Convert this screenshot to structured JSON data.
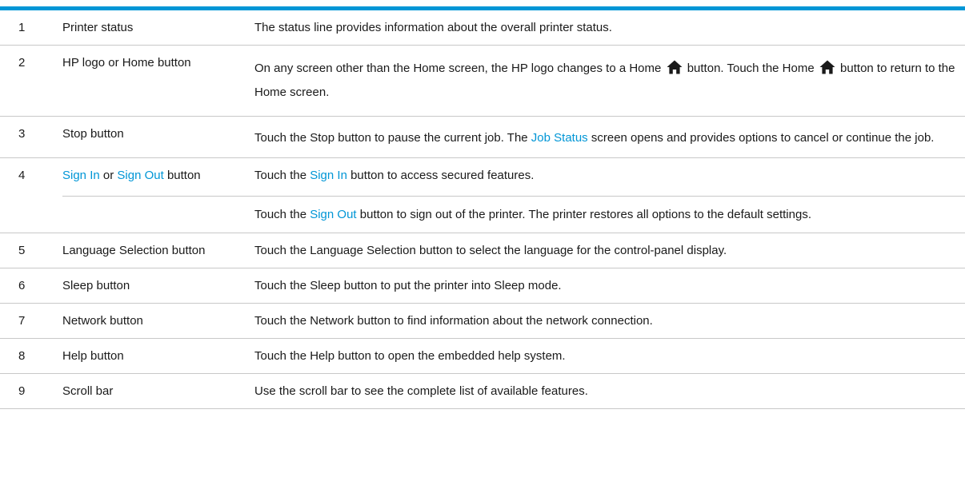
{
  "colors": {
    "accent": "#0096d6",
    "rule": "#c8c8c8"
  },
  "rows": [
    {
      "num": "1",
      "name": "Printer status",
      "desc": "The status line provides information about the overall printer status."
    },
    {
      "num": "2",
      "name": "HP logo or Home button",
      "desc_a": "On any screen other than the Home screen, the HP logo changes to a Home",
      "desc_b": "button. Touch the Home",
      "desc_c": "button to return to the Home screen.",
      "icon": "home-icon"
    },
    {
      "num": "3",
      "name": "Stop button",
      "desc_a": "Touch the Stop button to pause the current job. The",
      "desc_link": "Job Status",
      "desc_b": "screen opens and provides options to cancel or continue the job."
    },
    {
      "num": "4",
      "name_link_a": "Sign In",
      "name_mid": "or",
      "name_link_b": "Sign Out",
      "name_end": "button",
      "p1_a": "Touch the",
      "p1_link": "Sign In",
      "p1_b": "button to access secured features.",
      "p2_a": "Touch the",
      "p2_link": "Sign Out",
      "p2_b": "button to sign out of the printer. The printer restores all options to the default settings."
    },
    {
      "num": "5",
      "name": "Language Selection button",
      "desc": "Touch the Language Selection button to select the language for the control-panel display."
    },
    {
      "num": "6",
      "name": "Sleep button",
      "desc": "Touch the Sleep button to put the printer into Sleep mode."
    },
    {
      "num": "7",
      "name": "Network button",
      "desc": "Touch the Network button to find information about the network connection."
    },
    {
      "num": "8",
      "name": "Help button",
      "desc": "Touch the Help button to open the embedded help system."
    },
    {
      "num": "9",
      "name": "Scroll bar",
      "desc": "Use the scroll bar to see the complete list of available features."
    }
  ]
}
